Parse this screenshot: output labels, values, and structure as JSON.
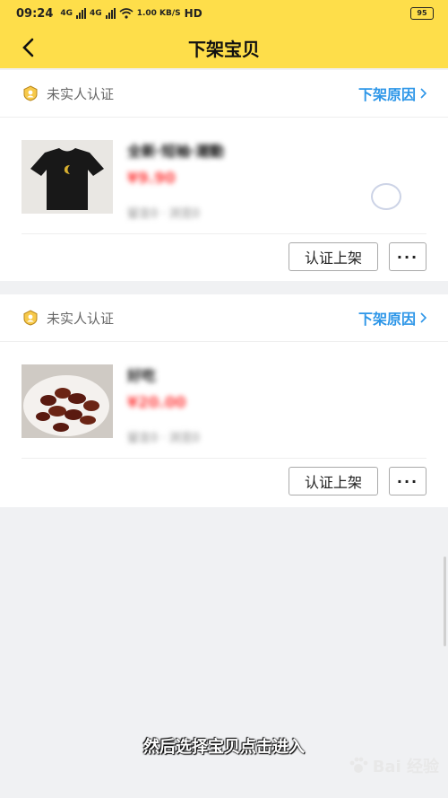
{
  "status": {
    "time": "09:24",
    "net_label1": "4G",
    "net_label2": "4G",
    "speed": "1.00 KB/S",
    "hd": "HD",
    "battery": "95"
  },
  "nav": {
    "title": "下架宝贝"
  },
  "cards": [
    {
      "cert_text": "未实人认证",
      "reason": "下架原因",
      "title": "全新·短袖·潮動",
      "price": "¥9.90",
      "meta": "留言0 · 浏览0",
      "cert_button": "认证上架",
      "more_button": "···"
    },
    {
      "cert_text": "未实人认证",
      "reason": "下架原因",
      "title": "好吃",
      "price": "¥20.00",
      "meta": "留言0 · 浏览0",
      "cert_button": "认证上架",
      "more_button": "···"
    }
  ],
  "subtitle": "然后选择宝贝点击进入",
  "watermark": "Bai 经验",
  "colors": {
    "brand_yellow": "#fede4a",
    "link_blue": "#2d96e8",
    "price_red": "#f44444"
  }
}
